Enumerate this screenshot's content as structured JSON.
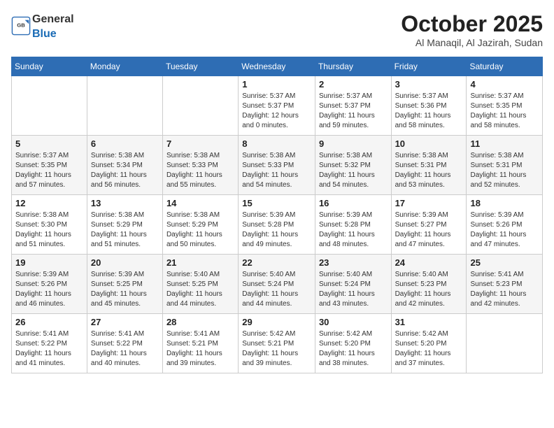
{
  "header": {
    "logo_general": "General",
    "logo_blue": "Blue",
    "month": "October 2025",
    "location": "Al Manaqil, Al Jazirah, Sudan"
  },
  "days_of_week": [
    "Sunday",
    "Monday",
    "Tuesday",
    "Wednesday",
    "Thursday",
    "Friday",
    "Saturday"
  ],
  "weeks": [
    [
      {
        "day": "",
        "info": ""
      },
      {
        "day": "",
        "info": ""
      },
      {
        "day": "",
        "info": ""
      },
      {
        "day": "1",
        "info": "Sunrise: 5:37 AM\nSunset: 5:37 PM\nDaylight: 12 hours and 0 minutes."
      },
      {
        "day": "2",
        "info": "Sunrise: 5:37 AM\nSunset: 5:37 PM\nDaylight: 11 hours and 59 minutes."
      },
      {
        "day": "3",
        "info": "Sunrise: 5:37 AM\nSunset: 5:36 PM\nDaylight: 11 hours and 58 minutes."
      },
      {
        "day": "4",
        "info": "Sunrise: 5:37 AM\nSunset: 5:35 PM\nDaylight: 11 hours and 58 minutes."
      }
    ],
    [
      {
        "day": "5",
        "info": "Sunrise: 5:37 AM\nSunset: 5:35 PM\nDaylight: 11 hours and 57 minutes."
      },
      {
        "day": "6",
        "info": "Sunrise: 5:38 AM\nSunset: 5:34 PM\nDaylight: 11 hours and 56 minutes."
      },
      {
        "day": "7",
        "info": "Sunrise: 5:38 AM\nSunset: 5:33 PM\nDaylight: 11 hours and 55 minutes."
      },
      {
        "day": "8",
        "info": "Sunrise: 5:38 AM\nSunset: 5:33 PM\nDaylight: 11 hours and 54 minutes."
      },
      {
        "day": "9",
        "info": "Sunrise: 5:38 AM\nSunset: 5:32 PM\nDaylight: 11 hours and 54 minutes."
      },
      {
        "day": "10",
        "info": "Sunrise: 5:38 AM\nSunset: 5:31 PM\nDaylight: 11 hours and 53 minutes."
      },
      {
        "day": "11",
        "info": "Sunrise: 5:38 AM\nSunset: 5:31 PM\nDaylight: 11 hours and 52 minutes."
      }
    ],
    [
      {
        "day": "12",
        "info": "Sunrise: 5:38 AM\nSunset: 5:30 PM\nDaylight: 11 hours and 51 minutes."
      },
      {
        "day": "13",
        "info": "Sunrise: 5:38 AM\nSunset: 5:29 PM\nDaylight: 11 hours and 51 minutes."
      },
      {
        "day": "14",
        "info": "Sunrise: 5:38 AM\nSunset: 5:29 PM\nDaylight: 11 hours and 50 minutes."
      },
      {
        "day": "15",
        "info": "Sunrise: 5:39 AM\nSunset: 5:28 PM\nDaylight: 11 hours and 49 minutes."
      },
      {
        "day": "16",
        "info": "Sunrise: 5:39 AM\nSunset: 5:28 PM\nDaylight: 11 hours and 48 minutes."
      },
      {
        "day": "17",
        "info": "Sunrise: 5:39 AM\nSunset: 5:27 PM\nDaylight: 11 hours and 47 minutes."
      },
      {
        "day": "18",
        "info": "Sunrise: 5:39 AM\nSunset: 5:26 PM\nDaylight: 11 hours and 47 minutes."
      }
    ],
    [
      {
        "day": "19",
        "info": "Sunrise: 5:39 AM\nSunset: 5:26 PM\nDaylight: 11 hours and 46 minutes."
      },
      {
        "day": "20",
        "info": "Sunrise: 5:39 AM\nSunset: 5:25 PM\nDaylight: 11 hours and 45 minutes."
      },
      {
        "day": "21",
        "info": "Sunrise: 5:40 AM\nSunset: 5:25 PM\nDaylight: 11 hours and 44 minutes."
      },
      {
        "day": "22",
        "info": "Sunrise: 5:40 AM\nSunset: 5:24 PM\nDaylight: 11 hours and 44 minutes."
      },
      {
        "day": "23",
        "info": "Sunrise: 5:40 AM\nSunset: 5:24 PM\nDaylight: 11 hours and 43 minutes."
      },
      {
        "day": "24",
        "info": "Sunrise: 5:40 AM\nSunset: 5:23 PM\nDaylight: 11 hours and 42 minutes."
      },
      {
        "day": "25",
        "info": "Sunrise: 5:41 AM\nSunset: 5:23 PM\nDaylight: 11 hours and 42 minutes."
      }
    ],
    [
      {
        "day": "26",
        "info": "Sunrise: 5:41 AM\nSunset: 5:22 PM\nDaylight: 11 hours and 41 minutes."
      },
      {
        "day": "27",
        "info": "Sunrise: 5:41 AM\nSunset: 5:22 PM\nDaylight: 11 hours and 40 minutes."
      },
      {
        "day": "28",
        "info": "Sunrise: 5:41 AM\nSunset: 5:21 PM\nDaylight: 11 hours and 39 minutes."
      },
      {
        "day": "29",
        "info": "Sunrise: 5:42 AM\nSunset: 5:21 PM\nDaylight: 11 hours and 39 minutes."
      },
      {
        "day": "30",
        "info": "Sunrise: 5:42 AM\nSunset: 5:20 PM\nDaylight: 11 hours and 38 minutes."
      },
      {
        "day": "31",
        "info": "Sunrise: 5:42 AM\nSunset: 5:20 PM\nDaylight: 11 hours and 37 minutes."
      },
      {
        "day": "",
        "info": ""
      }
    ]
  ]
}
